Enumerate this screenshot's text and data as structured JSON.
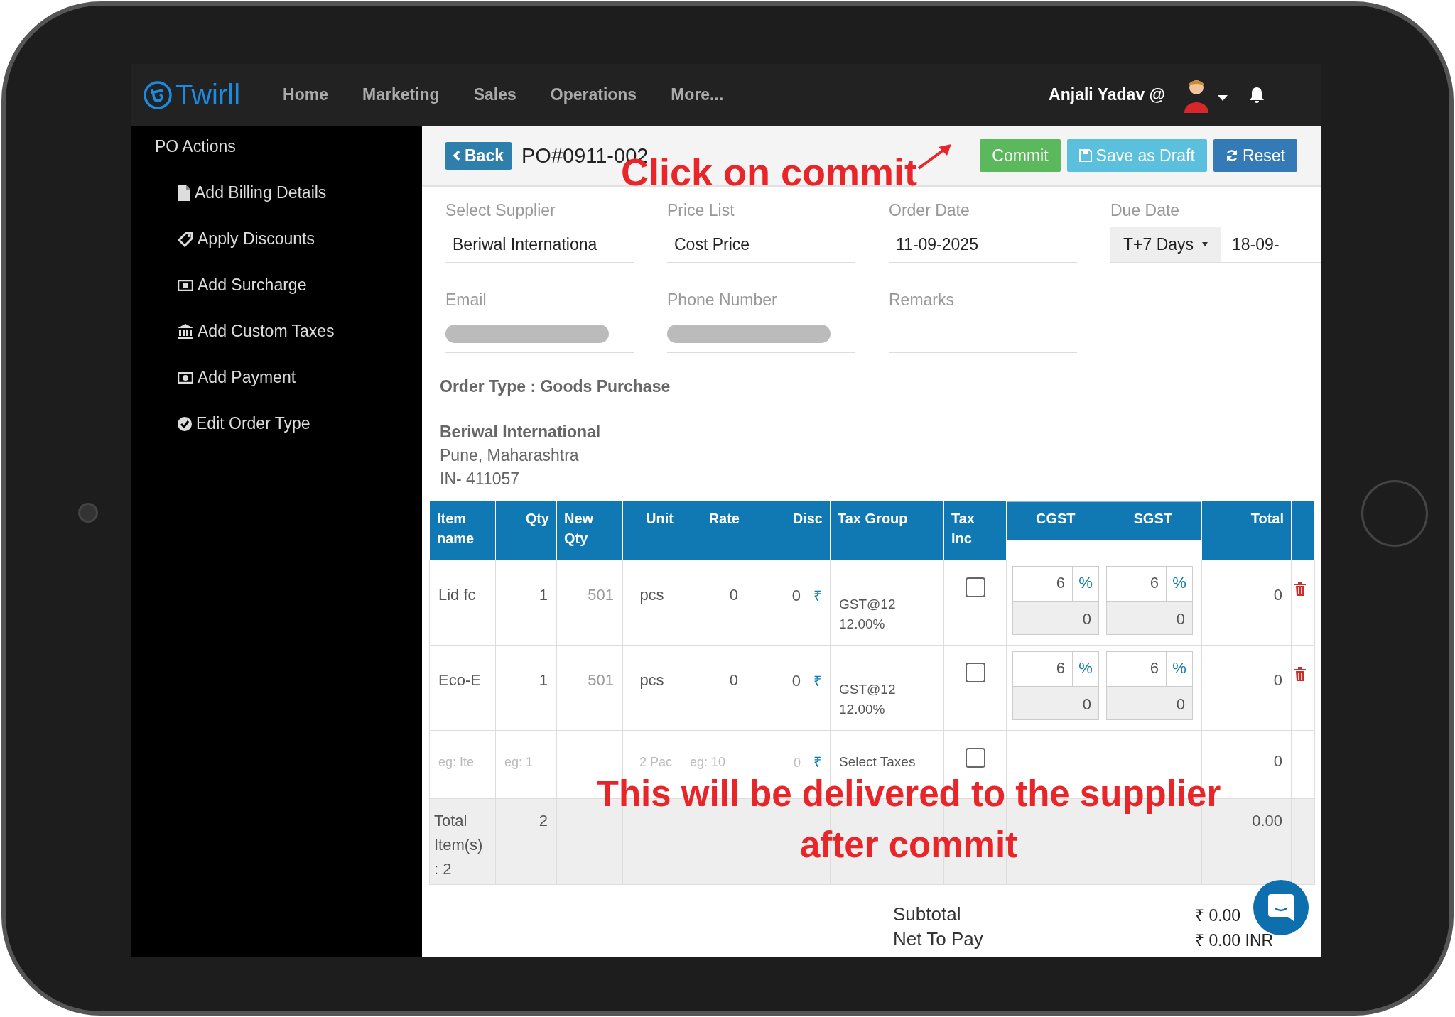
{
  "nav": {
    "logo": "Twirll",
    "items": [
      "Home",
      "Marketing",
      "Sales",
      "Operations",
      "More..."
    ],
    "user": "Anjali Yadav @"
  },
  "sidebar": {
    "title": "PO Actions",
    "items": [
      "Add Billing Details",
      "Apply Discounts",
      "Add Surcharge",
      "Add Custom Taxes",
      "Add Payment",
      "Edit Order Type"
    ]
  },
  "toolbar": {
    "back": "Back",
    "title": "PO#0911-002",
    "buttons": [
      {
        "label": "Commit",
        "kind": "commit"
      },
      {
        "label": "Save as Draft",
        "kind": "draft"
      },
      {
        "label": "Reset",
        "kind": "reset"
      }
    ]
  },
  "fields": [
    {
      "label": "Select Supplier",
      "value": "Beriwal Internationa"
    },
    {
      "label": "Price List",
      "value": "Cost Price"
    },
    {
      "label": "Order Date",
      "value": "11-09-2025"
    },
    {
      "label": "Due Date",
      "select": "T+7 Days",
      "value": "18-09-"
    },
    {
      "label": "Email",
      "redacted": true
    },
    {
      "label": "Phone Number",
      "redacted": true
    },
    {
      "label": "Remarks",
      "redacted": false
    }
  ],
  "order_type": "Order Type : Goods Purchase",
  "supplier": {
    "name": "Beriwal International",
    "lines": [
      "Pune, Maharashtra",
      "IN- 411057"
    ]
  },
  "table": {
    "columns": [
      "Item name",
      "Qty",
      "New Qty",
      "Unit",
      "Rate",
      "Disc",
      "Tax Group",
      "Tax Inc",
      "CGST",
      "SGST",
      "Total"
    ],
    "rows": [
      {
        "kind": "item",
        "item": "Lid fc",
        "qty": "1",
        "new_qty": "501",
        "unit": "pcs",
        "rate": "0",
        "disc": "0",
        "disc_symbol": "₹",
        "tax_group": "GST@12",
        "tax_rate": "12.00%",
        "tax_inc": false,
        "cgst": "6",
        "cgst_unit": "%",
        "cgst_amount": "0",
        "sgst": "6",
        "sgst_unit": "%",
        "sgst_amount": "0",
        "total": "0"
      },
      {
        "kind": "item",
        "item": "Eco-E",
        "qty": "1",
        "new_qty": "501",
        "unit": "pcs",
        "rate": "0",
        "disc": "0",
        "disc_symbol": "₹",
        "tax_group": "GST@12",
        "tax_rate": "12.00%",
        "tax_inc": false,
        "cgst": "6",
        "cgst_unit": "%",
        "cgst_amount": "0",
        "sgst": "6",
        "sgst_unit": "%",
        "sgst_amount": "0",
        "total": "0"
      },
      {
        "kind": "new",
        "item": {
          "placeholder": "eg: Ite"
        },
        "qty": {
          "placeholder": "eg: 1"
        },
        "unit": {
          "placeholder": "2 Pac"
        },
        "rate": {
          "placeholder": "eg: 10"
        },
        "disc": {
          "placeholder": "0"
        },
        "disc_symbol": "₹",
        "tax_group": "Select Taxes",
        "tax_inc": false,
        "total": "0"
      },
      {
        "kind": "total",
        "label": "Total Item(s) : 2",
        "qty": "2",
        "total": "0.00"
      }
    ]
  },
  "summary": [
    {
      "label": "Subtotal",
      "value": "₹ 0.00"
    },
    {
      "label": "Net To Pay",
      "value": "₹ 0.00 INR"
    }
  ],
  "annotations": {
    "commit_hint": "Click on commit",
    "supplier_hint": "This will be delivered to the supplier after commit"
  }
}
